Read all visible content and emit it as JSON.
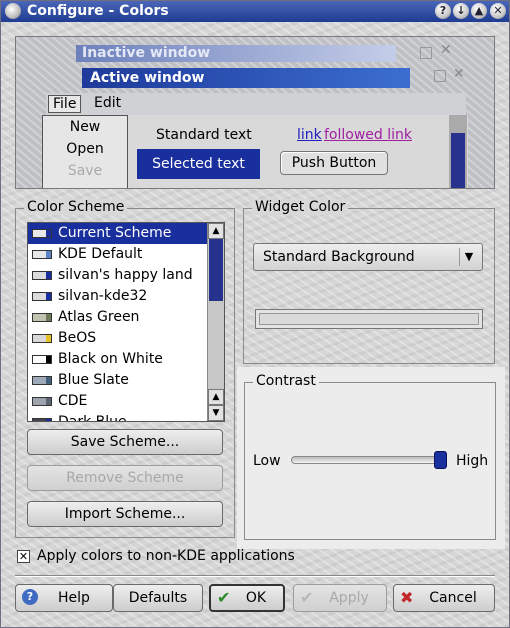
{
  "window": {
    "title": "Configure - Colors"
  },
  "titlebar_buttons": [
    "?",
    "↓",
    "▲",
    "✕"
  ],
  "preview": {
    "inactive_title": "Inactive window",
    "active_title": "Active window",
    "menu": [
      "File",
      "Edit"
    ],
    "file_menu_items": [
      "New",
      "Open",
      "Save"
    ],
    "standard_text": "Standard text",
    "selected_text": "Selected text",
    "link": "link",
    "followed_link": "followed link",
    "push_button": "Push Button"
  },
  "color_scheme": {
    "title": "Color Scheme",
    "selected_index": 0,
    "items": [
      {
        "label": "Current Scheme",
        "swatch": "#e8e8e8",
        "accent": "#1a2f9e"
      },
      {
        "label": "KDE Default",
        "swatch": "#e8e8e8",
        "accent": "#5b83c6"
      },
      {
        "label": "silvan's happy land",
        "swatch": "#dcdcdc",
        "accent": "#1a2f9e"
      },
      {
        "label": "silvan-kde32",
        "swatch": "#dcdcdc",
        "accent": "#1a2f9e"
      },
      {
        "label": "Atlas Green",
        "swatch": "#bfc3b0",
        "accent": "#6f7a5a"
      },
      {
        "label": "BeOS",
        "swatch": "#d8d8d8",
        "accent": "#e6c229"
      },
      {
        "label": "Black on White",
        "swatch": "#ffffff",
        "accent": "#000000"
      },
      {
        "label": "Blue Slate",
        "swatch": "#9eaab8",
        "accent": "#44607a"
      },
      {
        "label": "CDE",
        "swatch": "#9ea4ae",
        "accent": "#5b6573"
      },
      {
        "label": "Dark Blue",
        "swatch": "#445",
        "accent": "#1a2f9e"
      }
    ],
    "save_button": "Save Scheme...",
    "remove_button": "Remove Scheme",
    "import_button": "Import Scheme..."
  },
  "widget_color": {
    "title": "Widget Color",
    "selected": "Standard Background"
  },
  "contrast": {
    "title": "Contrast",
    "low_label": "Low",
    "high_label": "High",
    "value": 1.0
  },
  "apply_non_kde": {
    "label": "Apply colors to non-KDE applications",
    "checked": true
  },
  "buttons": {
    "help": "Help",
    "defaults": "Defaults",
    "ok": "OK",
    "apply": "Apply",
    "cancel": "Cancel"
  },
  "colors": {
    "selection": "#1a2f9e",
    "titlebar": "#1f3c93"
  }
}
